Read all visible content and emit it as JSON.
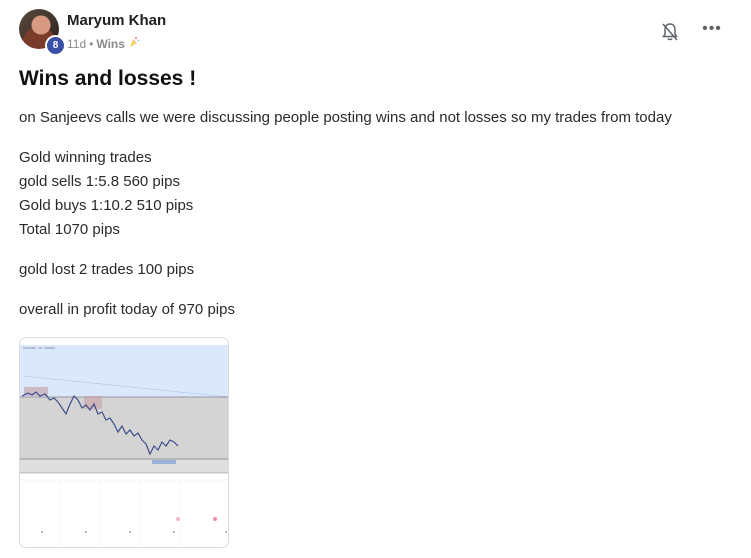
{
  "post": {
    "author": {
      "name": "Maryum Khan",
      "level": "8",
      "avatar_icon": "profile-photo"
    },
    "meta": {
      "time": "11d",
      "separator": "•",
      "category": "Wins",
      "category_icon": "celebration-icon"
    },
    "actions": {
      "notification_icon": "bell-off-icon",
      "more_icon": "more-horizontal-icon",
      "more_label": "•••"
    },
    "title": "Wins and losses !",
    "intro": "on Sanjeevs calls we were discussing people posting wins and not losses so my trades from today",
    "winning": [
      "Gold winning trades",
      "gold sells 1:5.8 560 pips",
      "Gold buys 1:10.2 510 pips",
      "Total 1070 pips"
    ],
    "losses": "gold lost 2 trades 100 pips",
    "summary": "overall in profit today of 970 pips",
    "attachment": {
      "type": "trading-chart-screenshot"
    }
  },
  "colors": {
    "badge": "#3a50a8",
    "title": "#111111",
    "text": "#2a2a2a",
    "meta": "#8a8a8a",
    "chart_blue_zone": "#dbe7fb",
    "chart_gray_zone": "#d4d4d4"
  }
}
